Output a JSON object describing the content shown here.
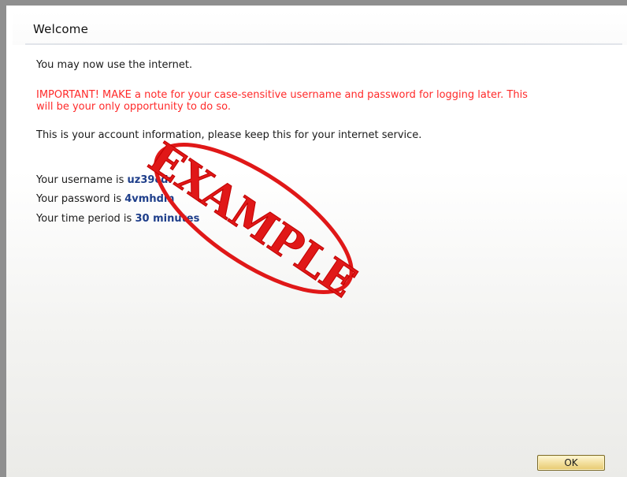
{
  "window": {
    "title": "Welcome"
  },
  "content": {
    "line1": "You may now use the internet.",
    "warning": "IMPORTANT! MAKE a note for your case-sensitive username and password for logging later. This will be your only opportunity to do so.",
    "account_info": "This is your account information, please keep this for your internet service.",
    "username_label": "Your username is ",
    "username_value": "uz39cdr",
    "password_label": "Your password is ",
    "password_value": "4vmhdm",
    "time_label": "Your time period is ",
    "time_value": "30 minutes"
  },
  "stamp": {
    "text": "EXAMPLE",
    "color": "#e01818"
  },
  "buttons": {
    "ok_label": "OK"
  },
  "colors": {
    "warning": "#ff2a2a",
    "value": "#1e3e8a",
    "button_top": "#fff7d6",
    "button_bottom": "#e7c96f"
  }
}
